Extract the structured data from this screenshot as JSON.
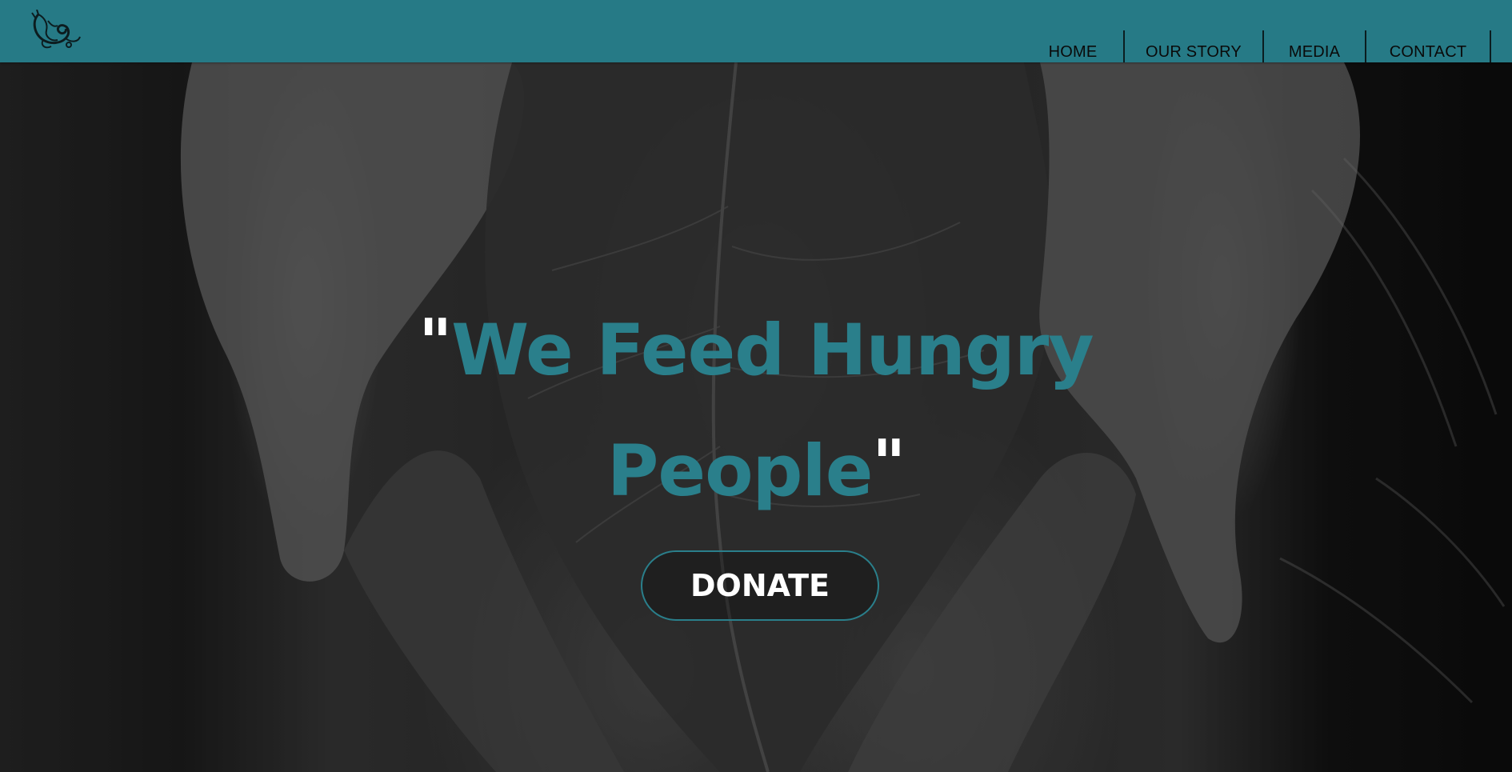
{
  "header": {
    "background_color": "#267a86",
    "logo_icon": "swirl-leaf-logo-icon"
  },
  "nav": {
    "items": [
      {
        "label": "HOME"
      },
      {
        "label": "OUR STORY"
      },
      {
        "label": "MEDIA"
      },
      {
        "label": "CONTACT"
      }
    ]
  },
  "hero": {
    "background": "black-and-white photo of cupped hands holding a dried leaf",
    "headline_open_quote": "\"",
    "headline_line1": "We Feed Hungry",
    "headline_line2": "People",
    "headline_close_quote": "\"",
    "headline_color": "#2a7f8b",
    "quote_color": "#ffffff",
    "donate_label": "DONATE"
  }
}
